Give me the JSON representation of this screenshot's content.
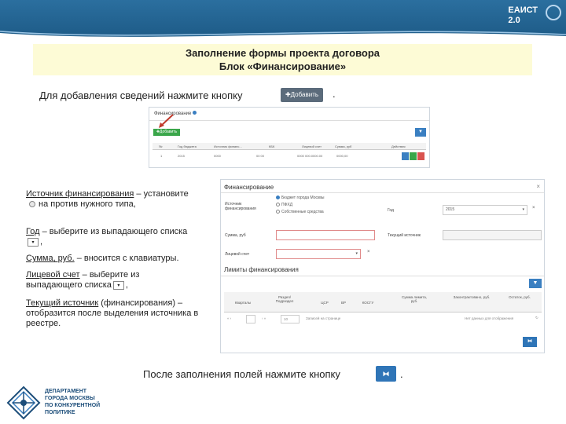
{
  "header": {
    "brand_line1": "ЕАИСТ",
    "brand_line2": "2.0"
  },
  "title": {
    "line1": "Заполнение формы проекта договора",
    "line2": "Блок «Финансирование»"
  },
  "intro": {
    "text": "Для добавления сведений нажмите кнопку",
    "button_label": "✚Добавить",
    "tail": "."
  },
  "shot1": {
    "title": "Финансирование",
    "add_label": "✚Добавить",
    "filter_icon": "▼",
    "columns": [
      "№",
      "Год бюджета",
      "Источник финанс...",
      "КБК",
      "Лицевой счет",
      "Сумма, руб",
      "Действия"
    ],
    "row": [
      "1",
      "2015",
      "0000",
      "00 00",
      "0000 000.0000.00",
      "0000,00"
    ]
  },
  "instructions": {
    "source_label": "Источник финансирования",
    "source_text_a": " – установите",
    "source_text_b": "на против нужного типа,",
    "year_label": "Год",
    "year_text": " – выберите из выпадающего списка",
    "year_tail": ",",
    "sum_label": "Сумма, руб.",
    "sum_text": " – вносится с клавиатуры.",
    "account_label": "Лицевой счет",
    "account_text": " – выберите из выпадающего списка",
    "account_tail": ",",
    "current_label": "Текущий источник",
    "current_text": " (финансирования) – отобразится после выделения источника в реестре.",
    "dropdown_glyph": "▾"
  },
  "shot2": {
    "title": "Финансирование",
    "close": "×",
    "source_label_1": "Источник",
    "source_label_2": "финансирования",
    "radios": [
      "Бюджет города Москвы",
      "ПФХД",
      "Собственные средства"
    ],
    "year_label": "Год",
    "year_value": "2015",
    "sum_label": "Сумма, руб",
    "current_source_label": "Текущий источник",
    "account_label": "Лицевой счет",
    "limits_title": "Лимиты финансирования",
    "columns": [
      "Кварталы",
      "Раздел/ Подраздел",
      "ЦСР",
      "ВР",
      "КОСГУ",
      "Сумма лимита, руб.",
      "Законтрактовано, руб.",
      "Остаток, руб."
    ],
    "pager_size": "10",
    "pager_text": "Записей на странице",
    "pager_empty": "Нет данных для отображения",
    "save_glyph": "⧓",
    "clear_glyph": "×",
    "filter_glyph": "▼"
  },
  "final": {
    "text": "После заполнения полей нажмите кнопку",
    "save_glyph": "⧓",
    "tail": "."
  },
  "logo_text": [
    "ДЕПАРТАМЕНТ",
    "ГОРОДА МОСКВЫ",
    "ПО КОНКУРЕНТНОЙ",
    "ПОЛИТИКЕ"
  ]
}
